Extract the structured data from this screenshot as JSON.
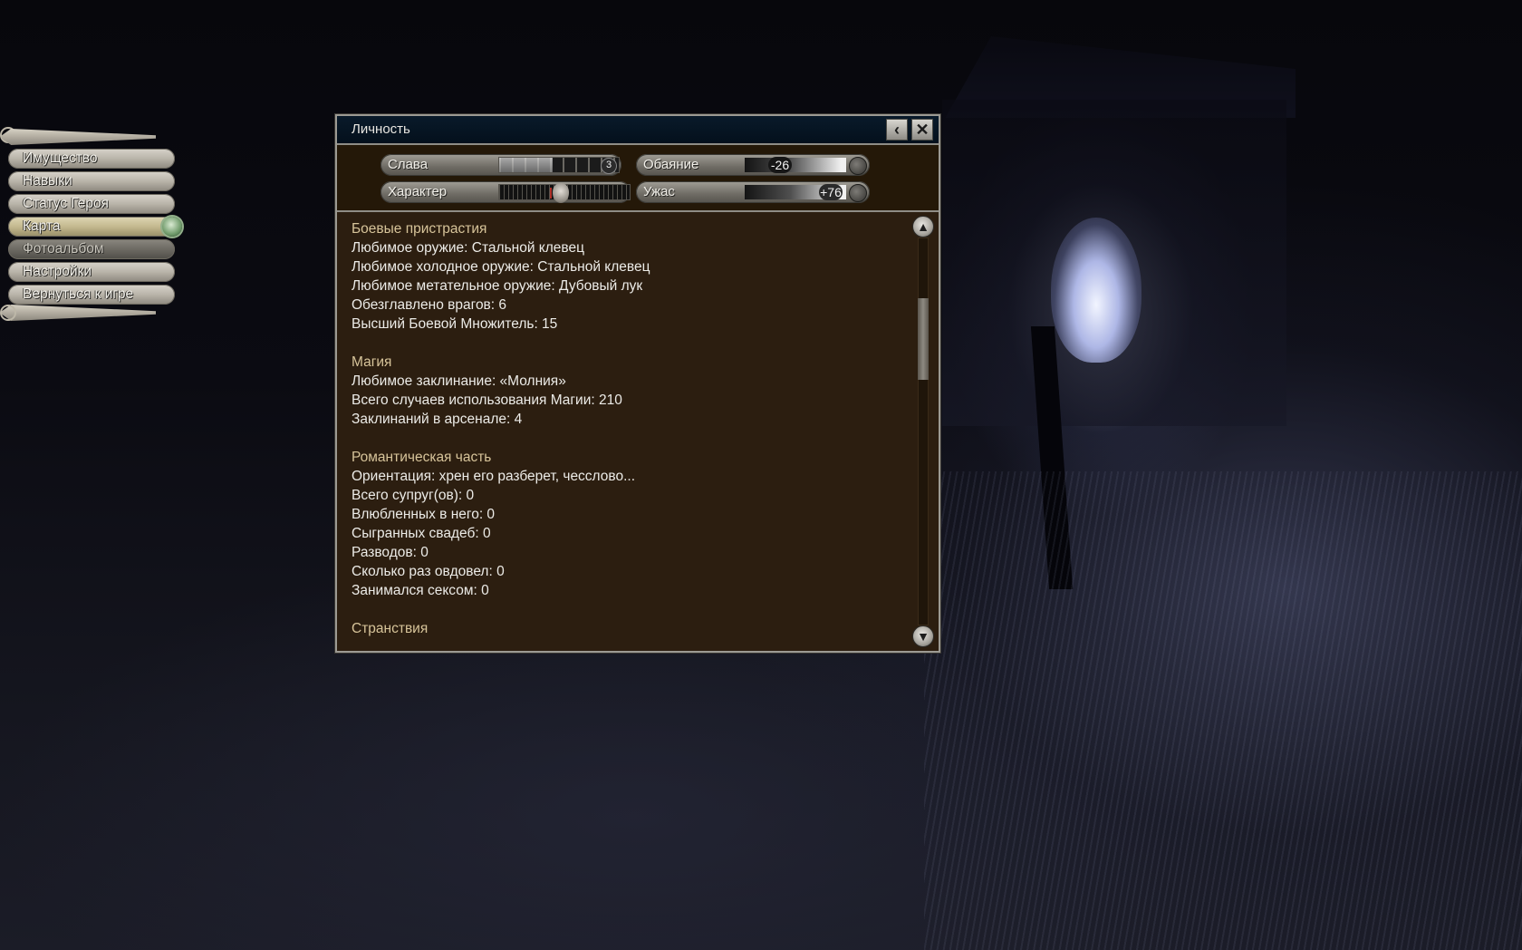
{
  "menu": {
    "items": [
      {
        "label": "Имущество",
        "state": "normal"
      },
      {
        "label": "Навыки",
        "state": "normal"
      },
      {
        "label": "Статус Героя",
        "state": "normal"
      },
      {
        "label": "Карта",
        "state": "active"
      },
      {
        "label": "Фотоальбом",
        "state": "dim"
      },
      {
        "label": "Настройки",
        "state": "normal"
      },
      {
        "label": "Вернуться к игре",
        "state": "normal"
      }
    ]
  },
  "window": {
    "title": "Личность",
    "back_icon": "chevron-left-icon",
    "close_icon": "close-icon"
  },
  "stats": {
    "fame": {
      "label": "Слава",
      "value": "3",
      "fill": 0.45
    },
    "character": {
      "label": "Характер",
      "level": 0.47
    },
    "charm": {
      "label": "Обаяние",
      "value": "-26"
    },
    "horror": {
      "label": "Ужас",
      "value": "+76"
    }
  },
  "sections": {
    "combat": {
      "heading": "Боевые пристрастия",
      "lines": [
        "Любимое оружие: Стальной клевец",
        "Любимое холодное оружие: Стальной клевец",
        "Любимое метательное оружие: Дубовый лук",
        "Обезглавлено врагов: 6",
        "Высший Боевой Множитель: 15"
      ]
    },
    "magic": {
      "heading": "Магия",
      "lines": [
        "Любимое заклинание: «Молния»",
        "Всего случаев использования Магии: 210",
        "Заклинаний в арсенале: 4"
      ]
    },
    "romance": {
      "heading": "Романтическая часть",
      "lines": [
        "Ориентация: хрен его разберет, чесслово...",
        "Всего супруг(ов): 0",
        "Влюбленных в него: 0",
        "Сыгранных свадеб: 0",
        "Разводов: 0",
        "Сколько раз овдовел: 0",
        "Занимался сексом: 0"
      ]
    },
    "travel": {
      "heading": "Странствия"
    }
  },
  "scroll": {
    "position": 0.2
  }
}
